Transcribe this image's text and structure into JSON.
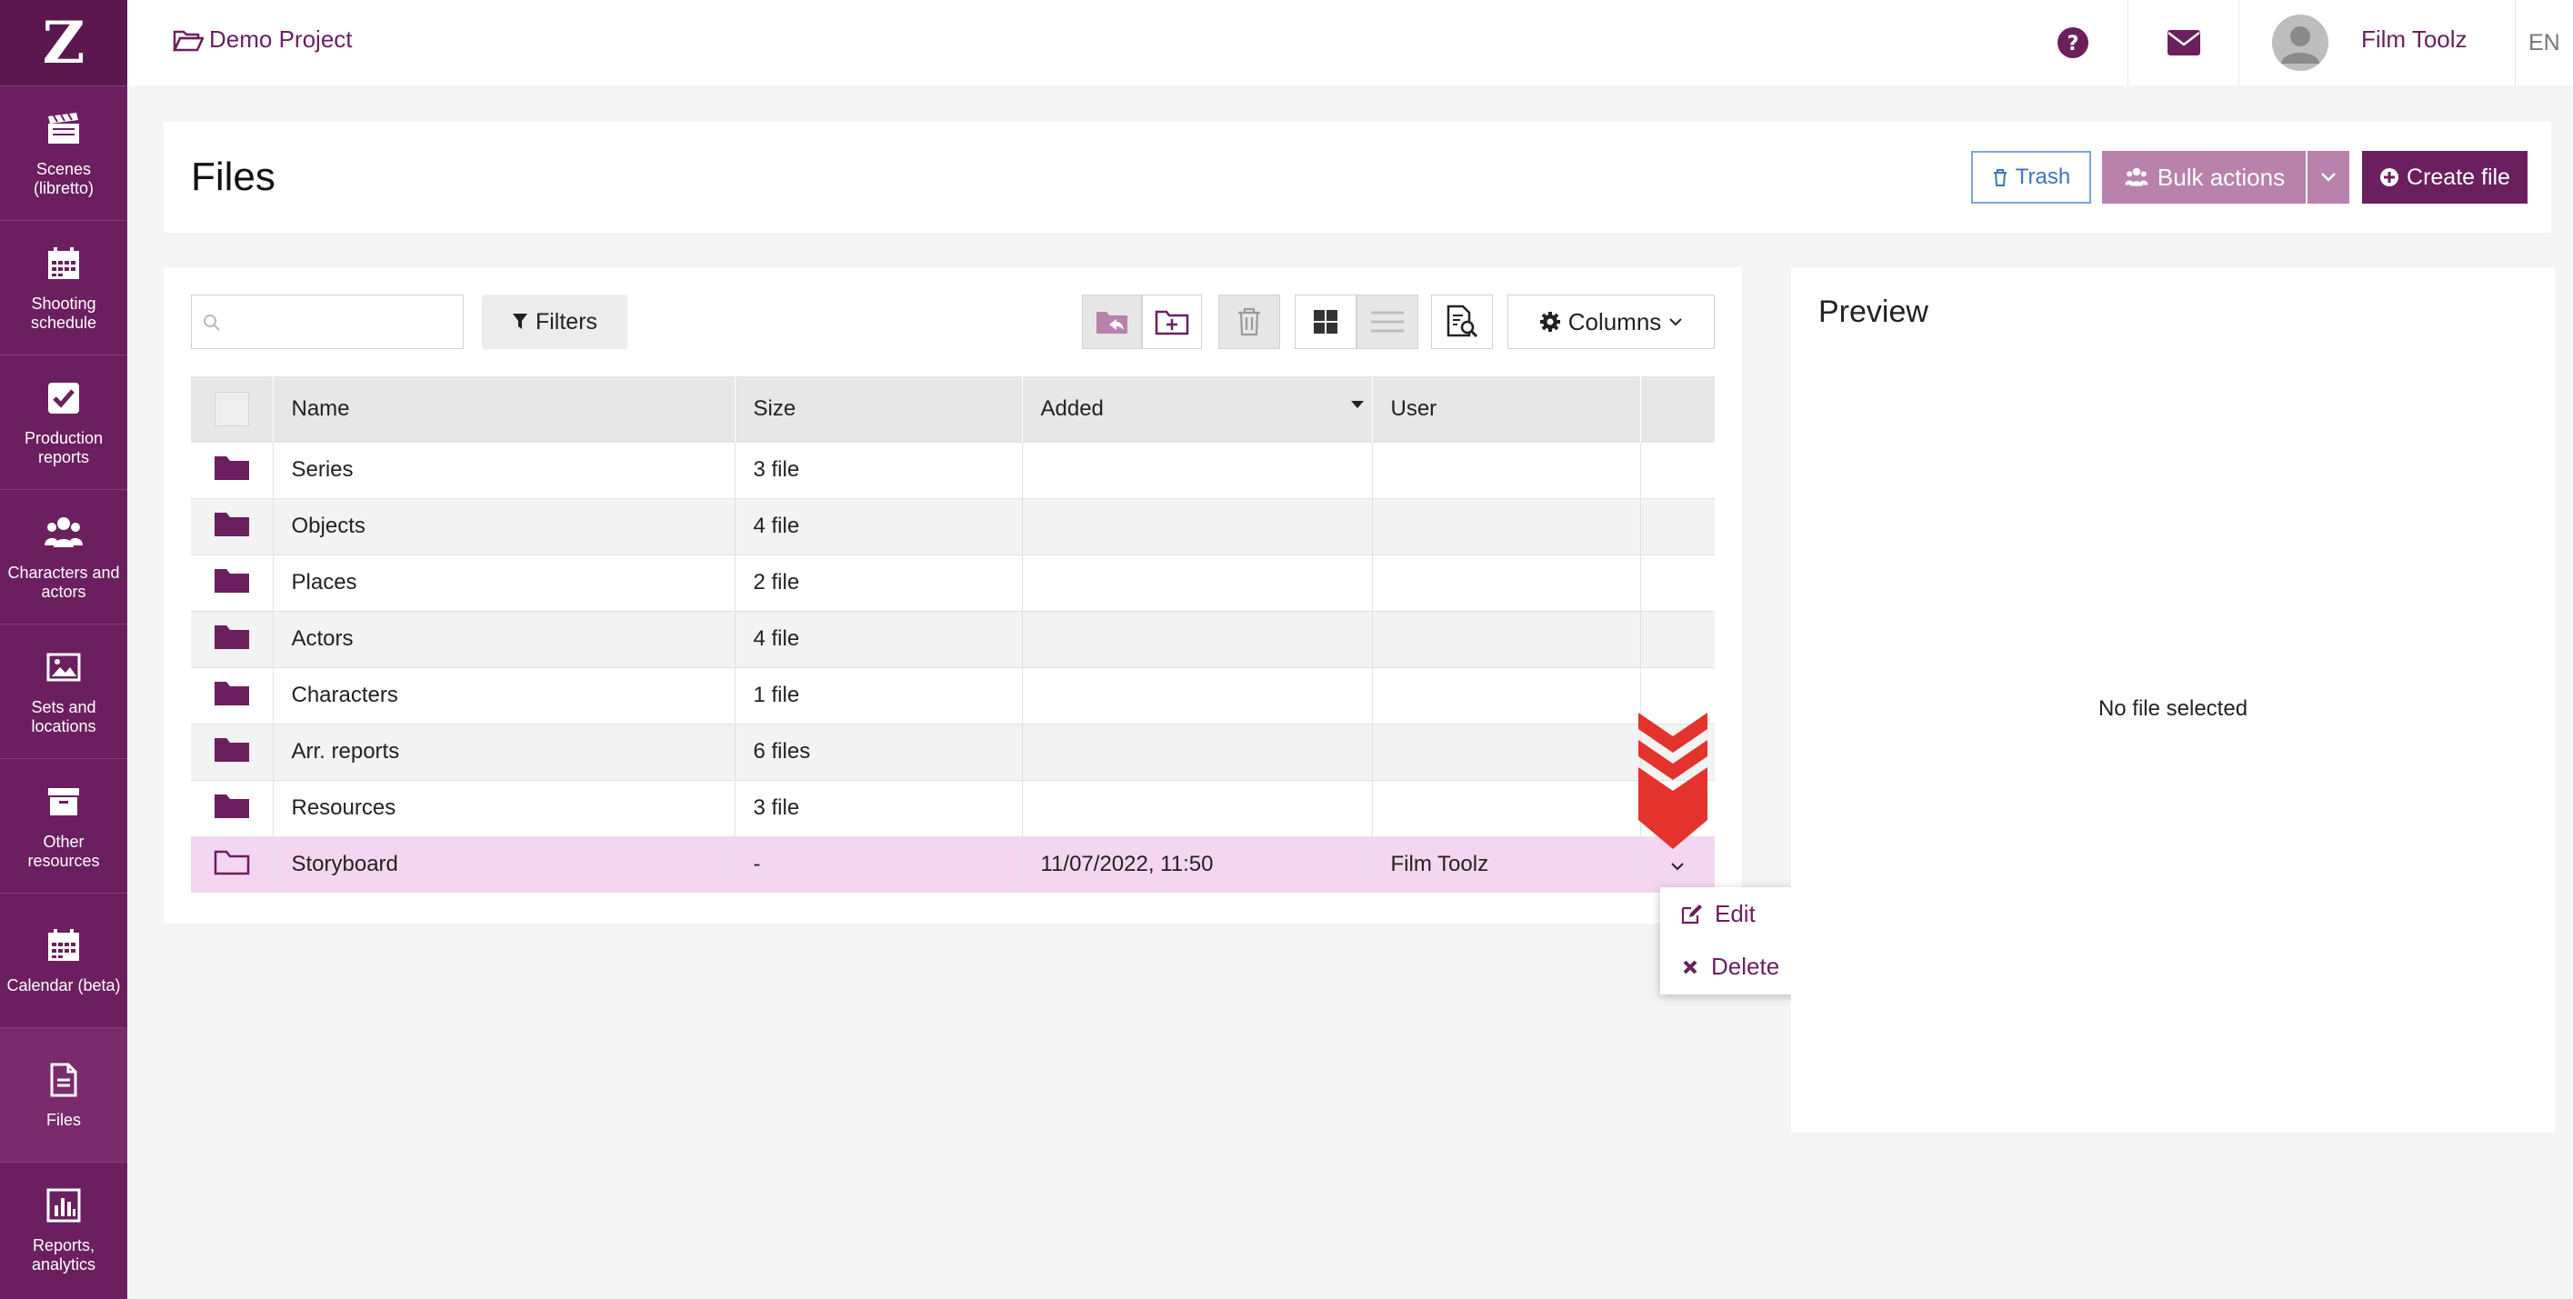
{
  "sidebar": {
    "logo": "Z",
    "items": [
      {
        "label": "Scenes (libretto)",
        "icon": "clapperboard-icon"
      },
      {
        "label": "Shooting schedule",
        "icon": "calendar-icon"
      },
      {
        "label": "Production reports",
        "icon": "checkbox-icon"
      },
      {
        "label": "Characters and actors",
        "icon": "users-icon"
      },
      {
        "label": "Sets and locations",
        "icon": "image-icon"
      },
      {
        "label": "Other resources",
        "icon": "archive-box-icon"
      },
      {
        "label": "Calendar (beta)",
        "icon": "calendar-icon"
      },
      {
        "label": "Files",
        "icon": "file-icon"
      },
      {
        "label": "Reports, analytics",
        "icon": "bar-chart-icon"
      }
    ]
  },
  "topbar": {
    "project": "Demo Project",
    "user": "Film Toolz",
    "lang": "EN"
  },
  "header": {
    "title": "Files",
    "trash": "Trash",
    "bulk": "Bulk actions",
    "create": "Create file"
  },
  "toolbar": {
    "search_placeholder": "",
    "filters": "Filters",
    "columns": "Columns"
  },
  "table": {
    "columns": [
      "Name",
      "Size",
      "Added",
      "User"
    ],
    "rows": [
      {
        "name": "Series",
        "size": "3 file",
        "added": "",
        "user": ""
      },
      {
        "name": "Objects",
        "size": "4 file",
        "added": "",
        "user": ""
      },
      {
        "name": "Places",
        "size": "2 file",
        "added": "",
        "user": ""
      },
      {
        "name": "Actors",
        "size": "4 file",
        "added": "",
        "user": ""
      },
      {
        "name": "Characters",
        "size": "1 file",
        "added": "",
        "user": ""
      },
      {
        "name": "Arr. reports",
        "size": "6 files",
        "added": "",
        "user": ""
      },
      {
        "name": "Resources",
        "size": "3 file",
        "added": "",
        "user": ""
      },
      {
        "name": "Storyboard",
        "size": "-",
        "added": "11/07/2022, 11:50",
        "user": "Film Toolz"
      }
    ]
  },
  "row_menu": {
    "edit": "Edit",
    "delete": "Delete"
  },
  "preview": {
    "title": "Preview",
    "empty": "No file selected"
  },
  "colors": {
    "brand": "#6b1f5e",
    "selected_row": "#f5d6f0",
    "arrow": "#e4322c"
  }
}
